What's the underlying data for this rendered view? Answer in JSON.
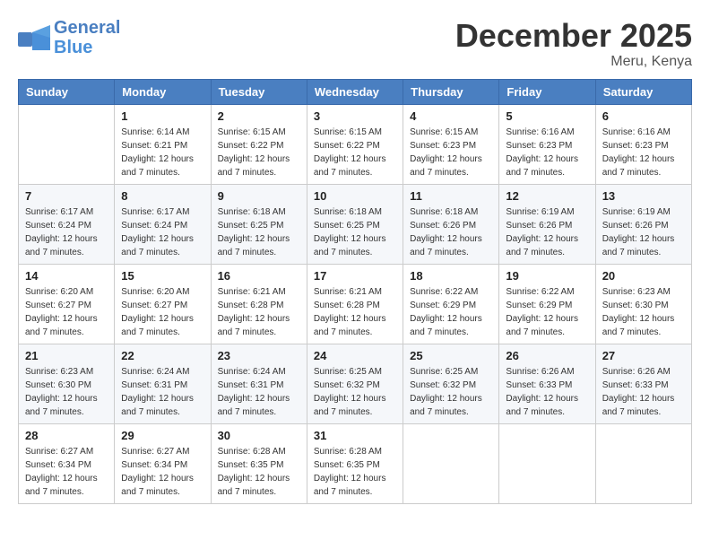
{
  "header": {
    "logo_line1": "General",
    "logo_line2": "Blue",
    "month_year": "December 2025",
    "location": "Meru, Kenya"
  },
  "days_of_week": [
    "Sunday",
    "Monday",
    "Tuesday",
    "Wednesday",
    "Thursday",
    "Friday",
    "Saturday"
  ],
  "weeks": [
    [
      {
        "day": "",
        "info": ""
      },
      {
        "day": "1",
        "info": "Sunrise: 6:14 AM\nSunset: 6:21 PM\nDaylight: 12 hours\nand 7 minutes."
      },
      {
        "day": "2",
        "info": "Sunrise: 6:15 AM\nSunset: 6:22 PM\nDaylight: 12 hours\nand 7 minutes."
      },
      {
        "day": "3",
        "info": "Sunrise: 6:15 AM\nSunset: 6:22 PM\nDaylight: 12 hours\nand 7 minutes."
      },
      {
        "day": "4",
        "info": "Sunrise: 6:15 AM\nSunset: 6:23 PM\nDaylight: 12 hours\nand 7 minutes."
      },
      {
        "day": "5",
        "info": "Sunrise: 6:16 AM\nSunset: 6:23 PM\nDaylight: 12 hours\nand 7 minutes."
      },
      {
        "day": "6",
        "info": "Sunrise: 6:16 AM\nSunset: 6:23 PM\nDaylight: 12 hours\nand 7 minutes."
      }
    ],
    [
      {
        "day": "7",
        "info": "Sunrise: 6:17 AM\nSunset: 6:24 PM\nDaylight: 12 hours\nand 7 minutes."
      },
      {
        "day": "8",
        "info": "Sunrise: 6:17 AM\nSunset: 6:24 PM\nDaylight: 12 hours\nand 7 minutes."
      },
      {
        "day": "9",
        "info": "Sunrise: 6:18 AM\nSunset: 6:25 PM\nDaylight: 12 hours\nand 7 minutes."
      },
      {
        "day": "10",
        "info": "Sunrise: 6:18 AM\nSunset: 6:25 PM\nDaylight: 12 hours\nand 7 minutes."
      },
      {
        "day": "11",
        "info": "Sunrise: 6:18 AM\nSunset: 6:26 PM\nDaylight: 12 hours\nand 7 minutes."
      },
      {
        "day": "12",
        "info": "Sunrise: 6:19 AM\nSunset: 6:26 PM\nDaylight: 12 hours\nand 7 minutes."
      },
      {
        "day": "13",
        "info": "Sunrise: 6:19 AM\nSunset: 6:26 PM\nDaylight: 12 hours\nand 7 minutes."
      }
    ],
    [
      {
        "day": "14",
        "info": "Sunrise: 6:20 AM\nSunset: 6:27 PM\nDaylight: 12 hours\nand 7 minutes."
      },
      {
        "day": "15",
        "info": "Sunrise: 6:20 AM\nSunset: 6:27 PM\nDaylight: 12 hours\nand 7 minutes."
      },
      {
        "day": "16",
        "info": "Sunrise: 6:21 AM\nSunset: 6:28 PM\nDaylight: 12 hours\nand 7 minutes."
      },
      {
        "day": "17",
        "info": "Sunrise: 6:21 AM\nSunset: 6:28 PM\nDaylight: 12 hours\nand 7 minutes."
      },
      {
        "day": "18",
        "info": "Sunrise: 6:22 AM\nSunset: 6:29 PM\nDaylight: 12 hours\nand 7 minutes."
      },
      {
        "day": "19",
        "info": "Sunrise: 6:22 AM\nSunset: 6:29 PM\nDaylight: 12 hours\nand 7 minutes."
      },
      {
        "day": "20",
        "info": "Sunrise: 6:23 AM\nSunset: 6:30 PM\nDaylight: 12 hours\nand 7 minutes."
      }
    ],
    [
      {
        "day": "21",
        "info": "Sunrise: 6:23 AM\nSunset: 6:30 PM\nDaylight: 12 hours\nand 7 minutes."
      },
      {
        "day": "22",
        "info": "Sunrise: 6:24 AM\nSunset: 6:31 PM\nDaylight: 12 hours\nand 7 minutes."
      },
      {
        "day": "23",
        "info": "Sunrise: 6:24 AM\nSunset: 6:31 PM\nDaylight: 12 hours\nand 7 minutes."
      },
      {
        "day": "24",
        "info": "Sunrise: 6:25 AM\nSunset: 6:32 PM\nDaylight: 12 hours\nand 7 minutes."
      },
      {
        "day": "25",
        "info": "Sunrise: 6:25 AM\nSunset: 6:32 PM\nDaylight: 12 hours\nand 7 minutes."
      },
      {
        "day": "26",
        "info": "Sunrise: 6:26 AM\nSunset: 6:33 PM\nDaylight: 12 hours\nand 7 minutes."
      },
      {
        "day": "27",
        "info": "Sunrise: 6:26 AM\nSunset: 6:33 PM\nDaylight: 12 hours\nand 7 minutes."
      }
    ],
    [
      {
        "day": "28",
        "info": "Sunrise: 6:27 AM\nSunset: 6:34 PM\nDaylight: 12 hours\nand 7 minutes."
      },
      {
        "day": "29",
        "info": "Sunrise: 6:27 AM\nSunset: 6:34 PM\nDaylight: 12 hours\nand 7 minutes."
      },
      {
        "day": "30",
        "info": "Sunrise: 6:28 AM\nSunset: 6:35 PM\nDaylight: 12 hours\nand 7 minutes."
      },
      {
        "day": "31",
        "info": "Sunrise: 6:28 AM\nSunset: 6:35 PM\nDaylight: 12 hours\nand 7 minutes."
      },
      {
        "day": "",
        "info": ""
      },
      {
        "day": "",
        "info": ""
      },
      {
        "day": "",
        "info": ""
      }
    ]
  ]
}
